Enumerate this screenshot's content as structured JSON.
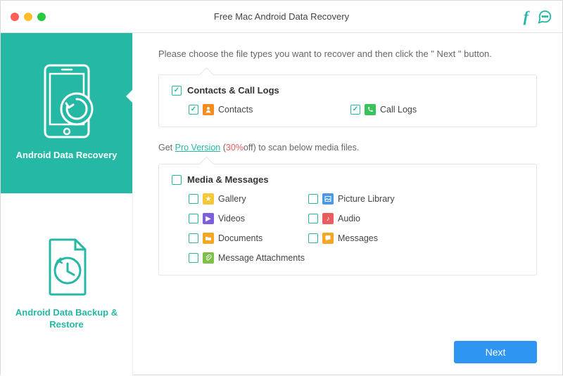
{
  "window": {
    "title": "Free Mac Android Data Recovery"
  },
  "titlebar": {
    "facebook_icon": "f",
    "chat_icon": "feedback"
  },
  "sidebar": {
    "tab1": {
      "label": "Android Data Recovery"
    },
    "tab2": {
      "label": "Android Data Backup & Restore"
    }
  },
  "main": {
    "instruction": "Please choose the file types you want to recover and then click the \" Next \" button.",
    "group1": {
      "title": "Contacts & Call Logs",
      "contacts": "Contacts",
      "calllogs": "Call Logs"
    },
    "promo": {
      "prefix": "Get ",
      "link": "Pro Version",
      "mid_open": " (",
      "off": "30%",
      "off_suffix": "off",
      "suffix": ") to scan below media files."
    },
    "group2": {
      "title": "Media & Messages",
      "gallery": "Gallery",
      "picture_library": "Picture Library",
      "videos": "Videos",
      "audio": "Audio",
      "documents": "Documents",
      "messages": "Messages",
      "attachments": "Message Attachments"
    },
    "next": "Next"
  }
}
